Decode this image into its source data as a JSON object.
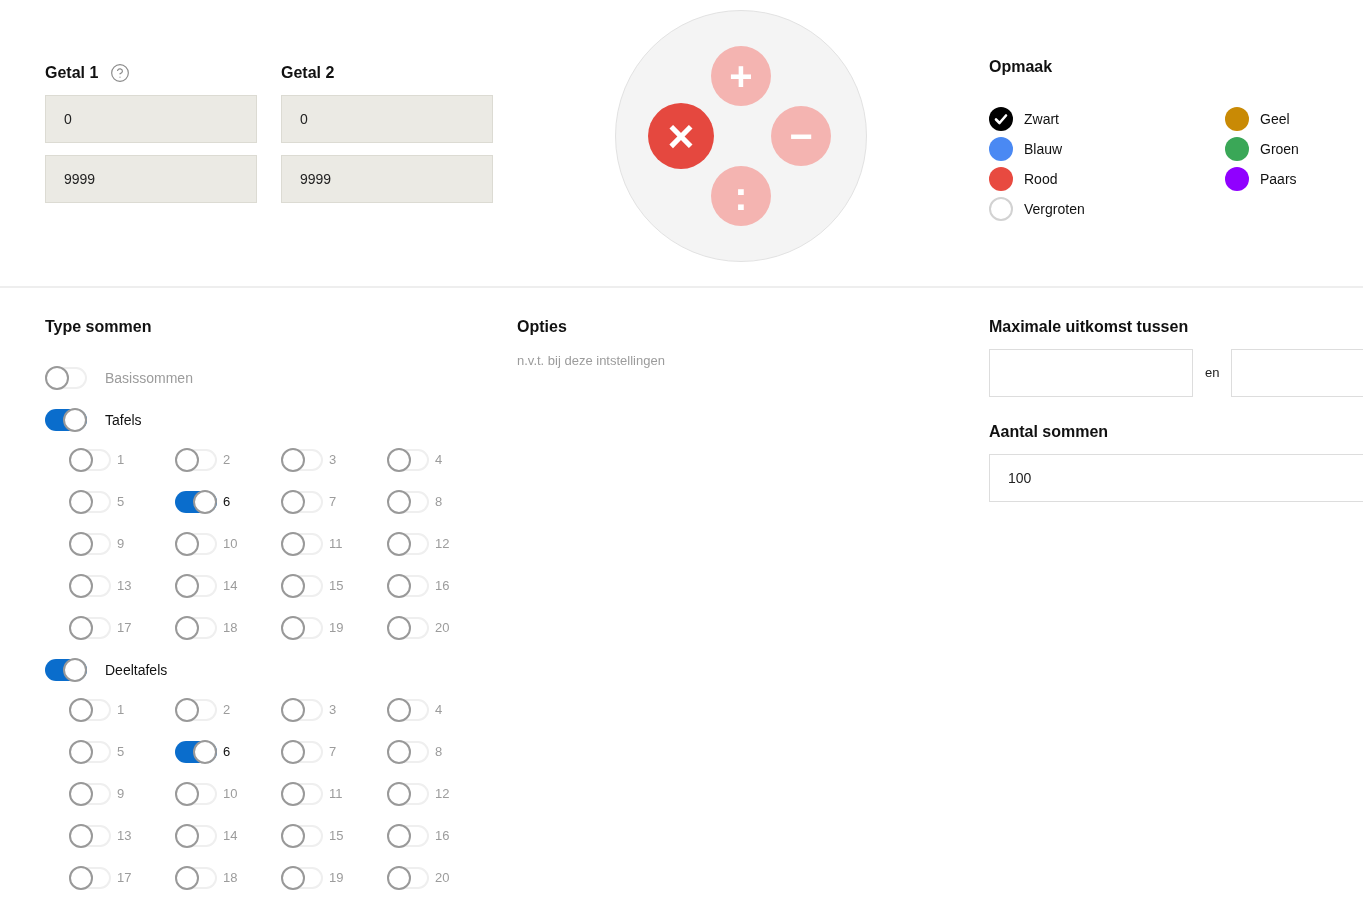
{
  "getallen": [
    {
      "label": "Getal 1",
      "help": true,
      "values": [
        "0",
        "9999"
      ]
    },
    {
      "label": "Getal 2",
      "help": false,
      "values": [
        "0",
        "9999"
      ]
    }
  ],
  "operations": [
    {
      "symbol": "+",
      "selected": false
    },
    {
      "symbol": "×",
      "selected": true
    },
    {
      "symbol": "−",
      "selected": false
    },
    {
      "symbol": ":",
      "selected": false
    }
  ],
  "opmaak": {
    "title": "Opmaak",
    "options": [
      {
        "kind": "color",
        "label": "Zwart",
        "color": "#000000",
        "selected": true
      },
      {
        "kind": "color",
        "label": "Blauw",
        "color": "#4a89f3",
        "selected": false
      },
      {
        "kind": "color",
        "label": "Rood",
        "color": "#e84a40",
        "selected": false
      },
      {
        "kind": "checkbox",
        "label": "Vergroten",
        "checked": false
      },
      {
        "kind": "color",
        "label": "Geel",
        "color": "#c98a05",
        "selected": false
      },
      {
        "kind": "color",
        "label": "Groen",
        "color": "#3aa757",
        "selected": false
      },
      {
        "kind": "color",
        "label": "Paars",
        "color": "#9000ff",
        "selected": false
      }
    ]
  },
  "type_sommen": {
    "title": "Type sommen",
    "items": [
      {
        "label": "Basissommen",
        "on": false
      },
      {
        "label": "Tafels",
        "on": true,
        "tables": [
          {
            "label": "1",
            "on": false
          },
          {
            "label": "2",
            "on": false
          },
          {
            "label": "3",
            "on": false
          },
          {
            "label": "4",
            "on": false
          },
          {
            "label": "5",
            "on": false
          },
          {
            "label": "6",
            "on": true
          },
          {
            "label": "7",
            "on": false
          },
          {
            "label": "8",
            "on": false
          },
          {
            "label": "9",
            "on": false
          },
          {
            "label": "10",
            "on": false
          },
          {
            "label": "11",
            "on": false
          },
          {
            "label": "12",
            "on": false
          },
          {
            "label": "13",
            "on": false
          },
          {
            "label": "14",
            "on": false
          },
          {
            "label": "15",
            "on": false
          },
          {
            "label": "16",
            "on": false
          },
          {
            "label": "17",
            "on": false
          },
          {
            "label": "18",
            "on": false
          },
          {
            "label": "19",
            "on": false
          },
          {
            "label": "20",
            "on": false
          }
        ]
      },
      {
        "label": "Deeltafels",
        "on": true,
        "tables": [
          {
            "label": "1",
            "on": false
          },
          {
            "label": "2",
            "on": false
          },
          {
            "label": "3",
            "on": false
          },
          {
            "label": "4",
            "on": false
          },
          {
            "label": "5",
            "on": false
          },
          {
            "label": "6",
            "on": true
          },
          {
            "label": "7",
            "on": false
          },
          {
            "label": "8",
            "on": false
          },
          {
            "label": "9",
            "on": false
          },
          {
            "label": "10",
            "on": false
          },
          {
            "label": "11",
            "on": false
          },
          {
            "label": "12",
            "on": false
          },
          {
            "label": "13",
            "on": false
          },
          {
            "label": "14",
            "on": false
          },
          {
            "label": "15",
            "on": false
          },
          {
            "label": "16",
            "on": false
          },
          {
            "label": "17",
            "on": false
          },
          {
            "label": "18",
            "on": false
          },
          {
            "label": "19",
            "on": false
          },
          {
            "label": "20",
            "on": false
          }
        ]
      }
    ]
  },
  "opties": {
    "title": "Opties",
    "note": "n.v.t. bij deze intstellingen"
  },
  "max_uitkomst": {
    "title": "Maximale uitkomst tussen",
    "separator": "en"
  },
  "aantal_sommen": {
    "title": "Aantal sommen",
    "value": "100"
  }
}
